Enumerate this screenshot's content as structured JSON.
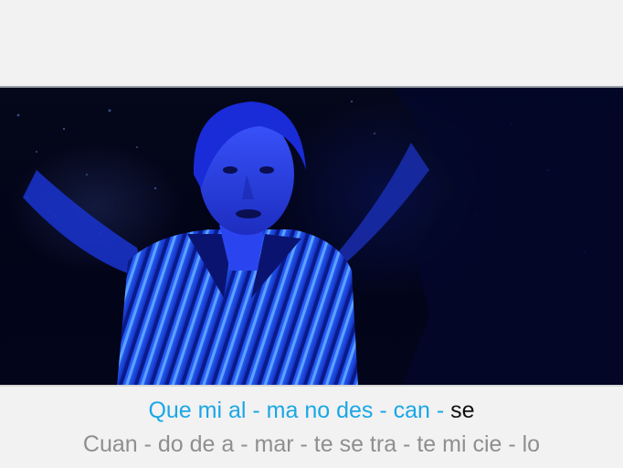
{
  "video": {
    "description_icon": "video-frame-icon",
    "tint_color": "#1e3cff"
  },
  "lyrics": {
    "current_line": {
      "sung": "Que mi al - ma no des - can - ",
      "unsung": "se",
      "sung_color": "#1aa7e6",
      "unsung_color": "#111111"
    },
    "next_line": {
      "text": "Cuan - do de a - mar - te se tra - te mi cie - lo",
      "color": "#8f8f8f"
    }
  }
}
